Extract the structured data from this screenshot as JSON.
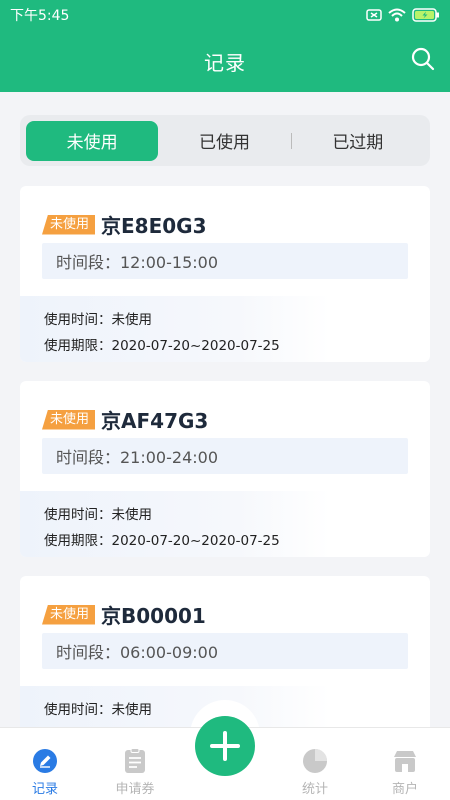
{
  "status_bar": {
    "time": "下午5:45"
  },
  "header": {
    "title": "记录"
  },
  "segment": {
    "tabs": [
      "未使用",
      "已使用",
      "已过期"
    ],
    "active": 0
  },
  "records": [
    {
      "tag": "未使用",
      "plate": "京E8E0G3",
      "period": "时间段：12:00-15:00",
      "use_time": "使用时间：未使用",
      "validity": "使用期限：2020-07-20~2020-07-25"
    },
    {
      "tag": "未使用",
      "plate": "京AF47G3",
      "period": "时间段：21:00-24:00",
      "use_time": "使用时间：未使用",
      "validity": "使用期限：2020-07-20~2020-07-25"
    },
    {
      "tag": "未使用",
      "plate": "京B00001",
      "period": "时间段：06:00-09:00",
      "use_time": "使用时间：未使用",
      "validity": ""
    }
  ],
  "bottom_nav": {
    "items": [
      {
        "label": "记录",
        "icon": "record-icon"
      },
      {
        "label": "申请券",
        "icon": "apply-coupon-icon"
      },
      {
        "label": "统计",
        "icon": "stats-icon"
      },
      {
        "label": "商户",
        "icon": "merchant-icon"
      }
    ],
    "fab_icon": "plus-icon"
  },
  "colors": {
    "primary": "#1fba7f",
    "tag": "#f5a040",
    "active_tab": "#2a7be4",
    "inactive": "#b5b5b5"
  }
}
